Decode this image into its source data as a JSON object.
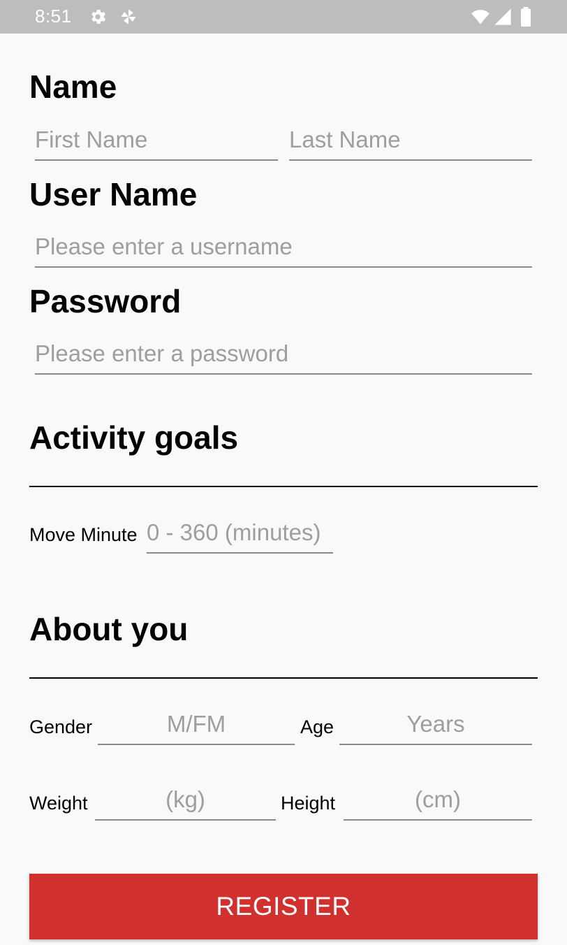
{
  "status_bar": {
    "time": "8:51",
    "icons": [
      "gear-icon",
      "pinwheel-icon",
      "wifi-icon",
      "signal-icon",
      "battery-icon"
    ]
  },
  "form": {
    "name_label": "Name",
    "first_name_placeholder": "First Name",
    "last_name_placeholder": "Last Name",
    "username_label": "User Name",
    "username_placeholder": "Please enter a username",
    "password_label": "Password",
    "password_placeholder": "Please enter a password",
    "activity_heading": "Activity goals",
    "move_minute_label": "Move Minute",
    "move_minute_placeholder": "0 - 360 (minutes)",
    "about_heading": "About you",
    "gender_label": "Gender",
    "gender_placeholder": "M/FM",
    "age_label": "Age",
    "age_placeholder": "Years",
    "weight_label": "Weight",
    "weight_placeholder": "(kg)",
    "height_label": "Height",
    "height_placeholder": "(cm)",
    "register_label": "REGISTER"
  },
  "colors": {
    "status_bar": "#bdbdbd",
    "background": "#f9f9f9",
    "register_button": "#d0302e",
    "placeholder": "#9e9e9e"
  }
}
